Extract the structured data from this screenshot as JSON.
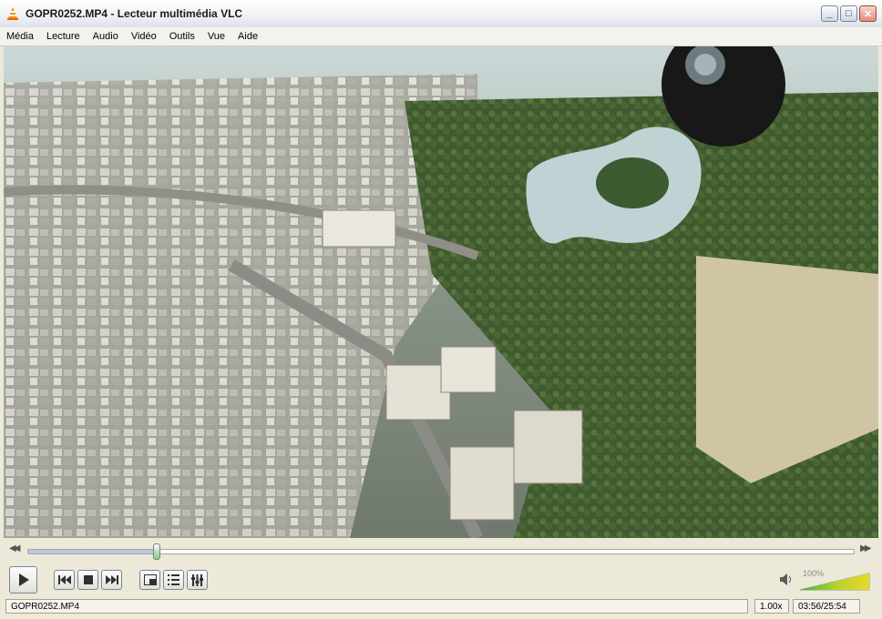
{
  "window": {
    "title": "GOPR0252.MP4 - Lecteur multimédia VLC"
  },
  "window_buttons": {
    "minimize": "_",
    "maximize": "□",
    "close": "✕"
  },
  "menu": [
    "Média",
    "Lecture",
    "Audio",
    "Vidéo",
    "Outils",
    "Vue",
    "Aide"
  ],
  "playback": {
    "position_fraction": 0.156,
    "seek_back_glyph": "◀◀",
    "seek_fwd_glyph": "▶▶"
  },
  "volume": {
    "label": "100%",
    "level_fraction": 1.0
  },
  "status": {
    "filename": "GOPR0252.MP4",
    "speed": "1.00x",
    "time": "03:56/25:54"
  },
  "icons": {
    "app": "vlc-cone-icon",
    "play": "play-icon",
    "prev": "previous-icon",
    "stop": "stop-icon",
    "next": "next-icon",
    "fullscreen": "fullscreen-icon",
    "playlist": "playlist-icon",
    "extended": "equalizer-icon",
    "speaker": "speaker-icon"
  },
  "colors": {
    "accent_orange": "#f08c00",
    "volume_green": "#46b336",
    "volume_yellow": "#e8d82a"
  }
}
